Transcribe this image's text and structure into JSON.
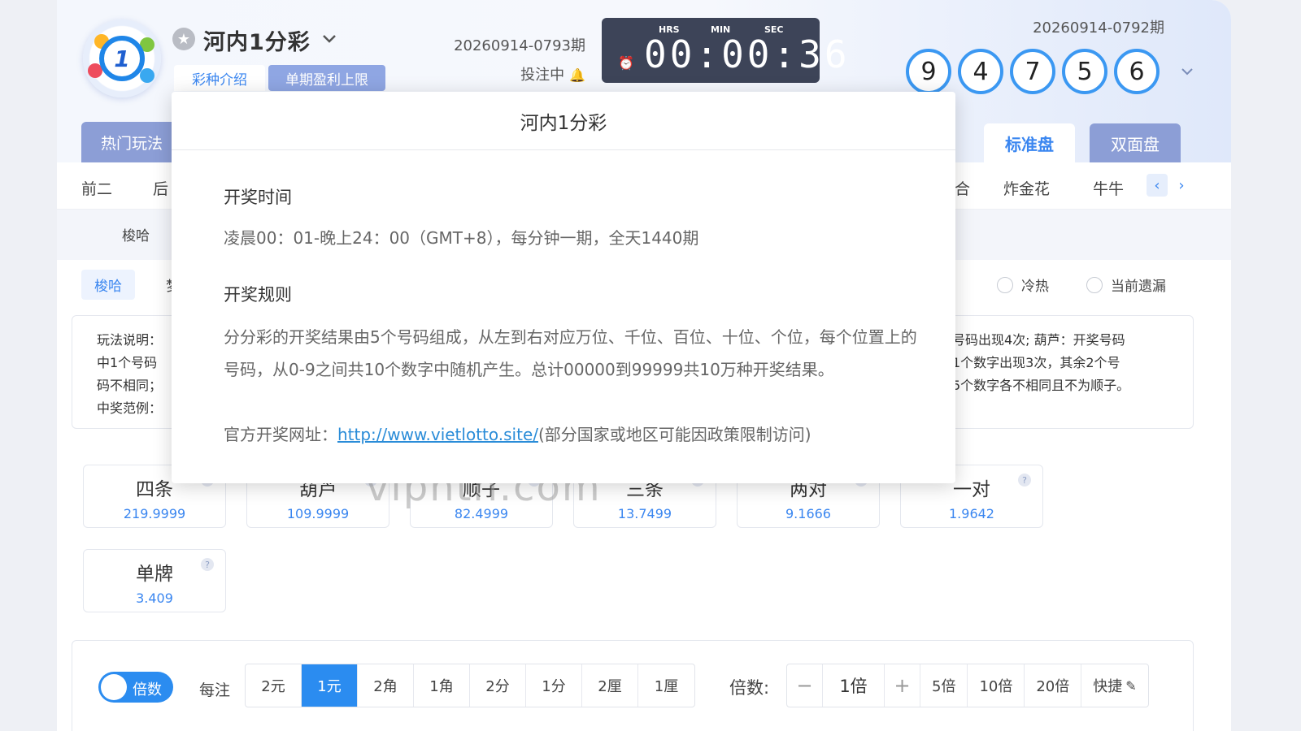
{
  "header": {
    "title": "河内1分彩",
    "tags": {
      "intro": "彩种介绍",
      "limit": "单期盈利上限"
    },
    "current_issue": "20260914-0793期",
    "status": "投注中",
    "timer": {
      "hrs_label": "HRS",
      "min_label": "MIN",
      "sec_label": "SEC",
      "value": "00:00:36"
    },
    "prev_issue": "20260914-0792期",
    "result_balls": [
      "9",
      "4",
      "7",
      "5",
      "6"
    ],
    "accent_color": "#3b98f2"
  },
  "tabs": {
    "hot": "热门玩法",
    "standard": "标准盘",
    "double": "双面盘"
  },
  "nav": {
    "items": [
      "前二",
      "后",
      "合",
      "炸金花",
      "牛牛"
    ]
  },
  "sub": {
    "item": "梭哈"
  },
  "play": {
    "pill": "梭哈",
    "pill_partial": "梦",
    "radio_hot": "冷热",
    "radio_miss": "当前遗漏"
  },
  "desc": {
    "left_lines": [
      "玩法说明：",
      "中1个号码",
      "码不相同；",
      "中奖范例："
    ],
    "right_lines": [
      "号码出现4次;  葫芦：开奖号码",
      "1个数字出现3次，其余2个号",
      "5个数字各不相同且不为顺子。"
    ]
  },
  "bets": [
    {
      "name": "四条",
      "odds": "219.9999"
    },
    {
      "name": "葫芦",
      "odds": "109.9999"
    },
    {
      "name": "顺子",
      "odds": "82.4999"
    },
    {
      "name": "三条",
      "odds": "13.7499"
    },
    {
      "name": "两对",
      "odds": "9.1666"
    },
    {
      "name": "一对",
      "odds": "1.9642"
    },
    {
      "name": "单牌",
      "odds": "3.409"
    }
  ],
  "bottom": {
    "toggle_label": "倍数",
    "unit_label": "每注",
    "units": [
      "2元",
      "1元",
      "2角",
      "1角",
      "2分",
      "1分",
      "2厘",
      "1厘"
    ],
    "active_unit": "1元",
    "multiplier_label": "倍数:",
    "multiplier_value": "1倍",
    "presets": [
      "5倍",
      "10倍",
      "20倍"
    ],
    "shortcut": "快捷"
  },
  "watermark": "viphth.com",
  "popup": {
    "title": "河内1分彩",
    "section1_title": "开奖时间",
    "section1_text": "凌晨00：01-晚上24：00（GMT+8），每分钟一期，全天1440期",
    "section2_title": "开奖规则",
    "section2_text": "分分彩的开奖结果由5个号码组成，从左到右对应万位、千位、百位、十位、个位，每个位置上的号码，从0-9之间共10个数字中随机产生。总计00000到99999共10万种开奖结果。",
    "site_label": "官方开奖网址：",
    "site_url": "http://www.vietlotto.site/",
    "site_note": "(部分国家或地区可能因政策限制访问)"
  }
}
